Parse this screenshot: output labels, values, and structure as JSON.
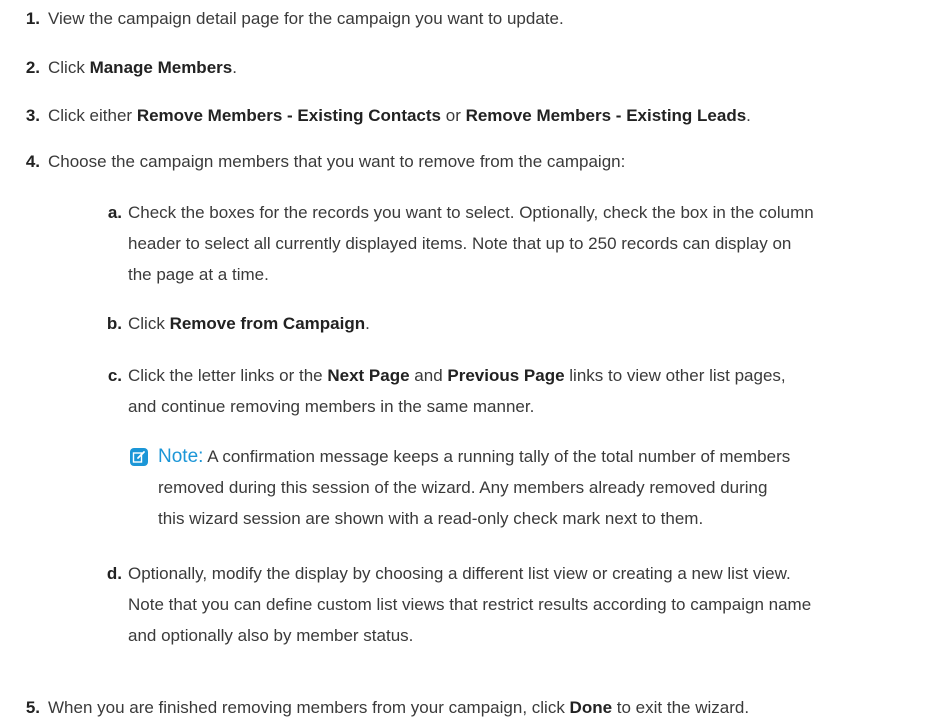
{
  "steps": [
    {
      "num": "1.",
      "text": "View the campaign detail page for the campaign you want to update."
    },
    {
      "num": "2.",
      "pre": "Click ",
      "b1": "Manage Members",
      "post": "."
    },
    {
      "num": "3.",
      "pre": "Click either ",
      "b1": "Remove Members - Existing Contacts",
      "mid": " or ",
      "b2": "Remove Members - Existing Leads",
      "post": "."
    },
    {
      "num": "4.",
      "text": "Choose the campaign members that you want to remove from the campaign:"
    },
    {
      "num": "5.",
      "pre": "When you are finished removing members from your campaign, click ",
      "b1": "Done",
      "post": " to exit the wizard."
    }
  ],
  "substeps": [
    {
      "num": "a.",
      "line1": "Check the boxes for the records you want to select. Optionally, check the box in the column",
      "line2": "header to select all currently displayed items. Note that up to 250 records can display on",
      "line3": "the page at a time."
    },
    {
      "num": "b.",
      "pre": "Click ",
      "b1": "Remove from Campaign",
      "post": "."
    },
    {
      "num": "c.",
      "pre": "Click the letter links or the ",
      "b1": "Next Page",
      "mid": " and ",
      "b2": "Previous Page",
      "post": " links to view other list pages,",
      "line2": "and continue removing members in the same manner."
    },
    {
      "num": "d.",
      "line1": "Optionally, modify the display by choosing a different list view or creating a new list view.",
      "line2": "Note that you can define custom list views that restrict results according to campaign name",
      "line3": "and optionally also by member status."
    }
  ],
  "note": {
    "label": "Note:",
    "line1": " A confirmation message keeps a running tally of the total number of members",
    "line2": "removed during this session of the wizard. Any members already removed during",
    "line3": "this wizard session are shown with a read-only check mark next to them.",
    "icon": "edit-note-icon",
    "color": "#1b96d7"
  }
}
